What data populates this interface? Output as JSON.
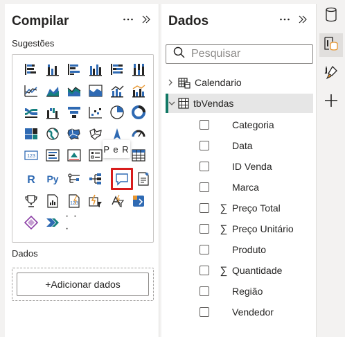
{
  "build_pane": {
    "title": "Compilar",
    "suggestions_label": "Sugestões",
    "data_label": "Dados",
    "add_data_button": "+Adicionar dados",
    "more_visuals": "· · ·",
    "tooltip": "P e R"
  },
  "data_pane": {
    "title": "Dados",
    "search_placeholder": "Pesquisar",
    "tables": [
      {
        "name": "Calendario",
        "expanded": false
      },
      {
        "name": "tbVendas",
        "expanded": true,
        "selected": true
      }
    ],
    "fields": [
      {
        "label": "Categoria",
        "sigma": false
      },
      {
        "label": "Data",
        "sigma": false
      },
      {
        "label": "ID Venda",
        "sigma": false
      },
      {
        "label": "Marca",
        "sigma": false
      },
      {
        "label": "Preço Total",
        "sigma": true
      },
      {
        "label": "Preço Unitário",
        "sigma": true
      },
      {
        "label": "Produto",
        "sigma": false
      },
      {
        "label": "Quantidade",
        "sigma": true
      },
      {
        "label": "Região",
        "sigma": false
      },
      {
        "label": "Vendedor",
        "sigma": false
      }
    ],
    "sigma_symbol": "∑"
  },
  "icons": {
    "more": "more-options-icon",
    "expand": "expand-pane-icon",
    "search": "search-icon",
    "rail": [
      "data-cylinder-icon",
      "build-visual-icon",
      "format-brush-icon",
      "add-icon"
    ]
  },
  "colors": {
    "accent": "#117865",
    "highlight": "#d81c1c",
    "visual_blue": "#2f6ab3",
    "visual_teal": "#15807e",
    "visual_dark": "#252423",
    "visual_orange": "#e8962e",
    "visual_purple": "#8c3fa6"
  }
}
